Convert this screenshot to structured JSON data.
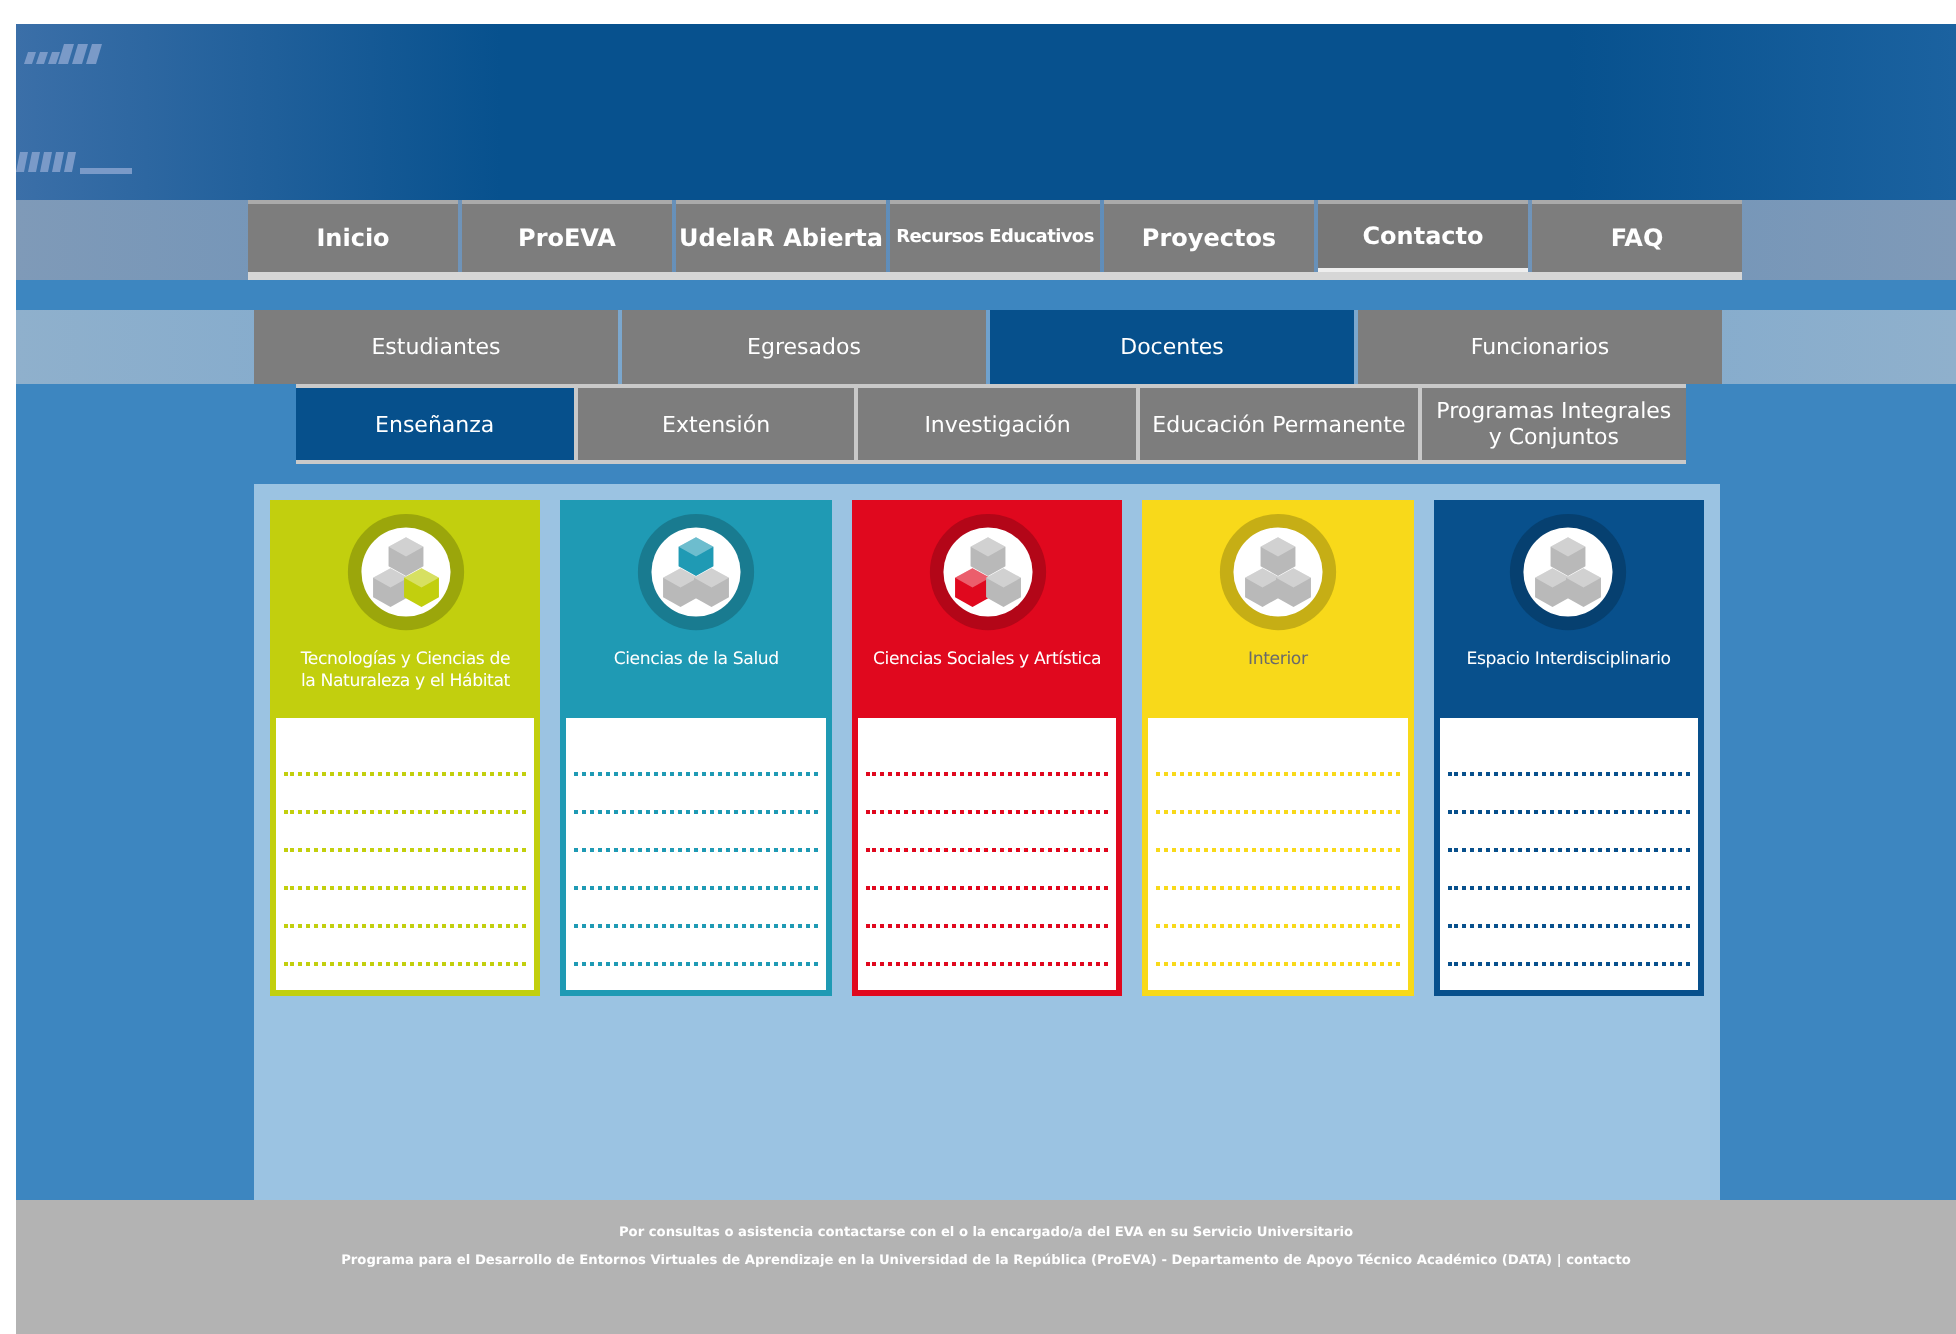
{
  "main_menu": [
    {
      "label": "Inicio",
      "selected": false
    },
    {
      "label": "ProEVA",
      "selected": false
    },
    {
      "label": "UdelaR Abierta",
      "selected": false
    },
    {
      "label": "Recursos Educativos",
      "selected": false
    },
    {
      "label": "Proyectos",
      "selected": false
    },
    {
      "label": "Contacto",
      "selected": true
    },
    {
      "label": "FAQ",
      "selected": false
    }
  ],
  "audience_tabs": [
    {
      "label": "Estudiantes",
      "selected": false
    },
    {
      "label": "Egresados",
      "selected": false
    },
    {
      "label": "Docentes",
      "selected": true
    },
    {
      "label": "Funcionarios",
      "selected": false
    }
  ],
  "sub_tabs": [
    {
      "label": "Enseñanza",
      "selected": true
    },
    {
      "label": "Extensión",
      "selected": false
    },
    {
      "label": "Investigación",
      "selected": false
    },
    {
      "label": "Educación Permanente",
      "selected": false
    },
    {
      "label": "Programas Integrales y Conjuntos",
      "selected": false
    }
  ],
  "areas": [
    {
      "title": "Tecnologías y Ciencias de la Naturaleza y el Hábitat",
      "color": "#c2cf0e",
      "kind": "right"
    },
    {
      "title": "Ciencias de la Salud",
      "color": "#1f9ab4",
      "kind": "top"
    },
    {
      "title": "Ciencias Sociales y Artística",
      "color": "#e0081e",
      "kind": "left"
    },
    {
      "title": "Interior",
      "color": "#f8d91a",
      "kind": "plain"
    },
    {
      "title": "Espacio Interdisciplinario",
      "color": "#08508c",
      "kind": "plain"
    }
  ],
  "footer": {
    "line_1": "Por consultas o asistencia contactarse con el o la encargado/a del EVA en su Servicio Universitario",
    "line_2": "Programa para el Desarrollo de Entornos Virtuales de Aprendizaje en la Universidad de la República (ProEVA) - Departamento de Apoyo Técnico Académico (DATA) |",
    "link": "contacto"
  }
}
